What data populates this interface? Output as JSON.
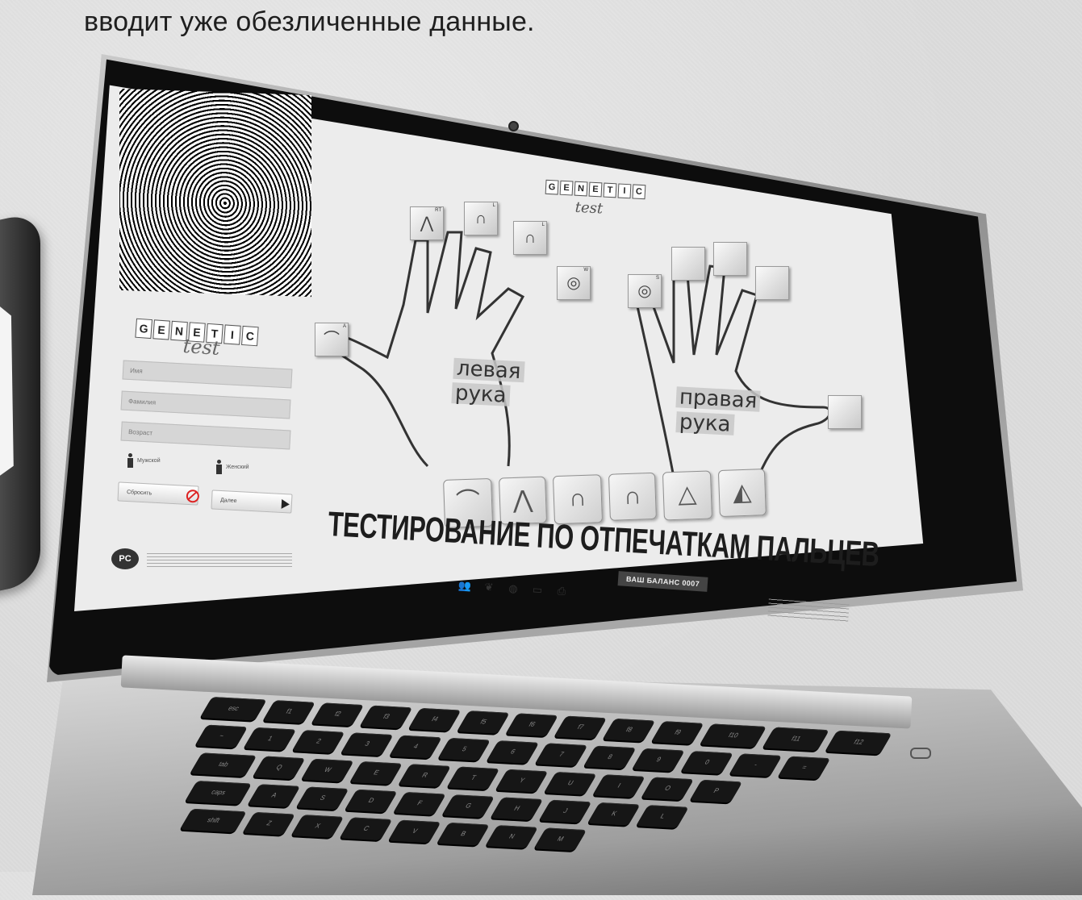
{
  "caption": {
    "text": "вводит уже обезличенные данные."
  },
  "screen": {
    "logo": {
      "letters": [
        "G",
        "E",
        "N",
        "E",
        "T",
        "I",
        "C"
      ],
      "subtitle": "test"
    },
    "form": {
      "fields": [
        {
          "placeholder": "Имя"
        },
        {
          "placeholder": "Фамилия"
        },
        {
          "placeholder": "Возраст"
        }
      ],
      "gender_male": "Мужской",
      "gender_female": "Женский",
      "clear_button": "Сбросить",
      "next_button": "Далее"
    },
    "left_hand": {
      "label_line1": "левая",
      "label_line2": "рука",
      "fingers": [
        {
          "tag": "A",
          "icon": "arch-icon"
        },
        {
          "tag": "RT",
          "icon": "tented-arch-icon"
        },
        {
          "tag": "L",
          "icon": "loop-icon"
        },
        {
          "tag": "L",
          "icon": "loop-icon"
        },
        {
          "tag": "W",
          "icon": "whorl-icon"
        }
      ]
    },
    "right_hand": {
      "label_line1": "правая",
      "label_line2": "рука",
      "fingers": [
        {
          "tag": "S",
          "icon": "whorl-icon"
        },
        {
          "tag": "",
          "icon": "empty"
        },
        {
          "tag": "",
          "icon": "empty"
        },
        {
          "tag": "",
          "icon": "empty"
        },
        {
          "tag": "",
          "icon": "empty"
        }
      ]
    },
    "patterns": [
      "arch-icon",
      "tented-arch-icon",
      "loop-icon",
      "loop-icon",
      "whorl-icon",
      "whorl-icon"
    ],
    "headline": "ТЕСТИРОВАНИЕ ПО ОТПЕЧАТКАМ ПАЛЬЦЕВ",
    "balance": "ВАШ БАЛАНС 0007",
    "toolbar_icons": [
      "users-icon",
      "chat-icon",
      "globe-icon",
      "monitor-icon",
      "printer-icon"
    ],
    "rst_badge": "PC"
  },
  "keyboard": {
    "row1": [
      "esc",
      "f1",
      "f2",
      "f3",
      "f4",
      "f5",
      "f6",
      "f7",
      "f8",
      "f9",
      "f10",
      "f11",
      "f12"
    ],
    "row2": [
      "~",
      "1",
      "2",
      "3",
      "4",
      "5",
      "6",
      "7",
      "8",
      "9",
      "0",
      "-",
      "="
    ],
    "row3": [
      "tab",
      "Q",
      "W",
      "E",
      "R",
      "T",
      "Y",
      "U",
      "I",
      "O",
      "P"
    ],
    "row4": [
      "caps",
      "A",
      "S",
      "D",
      "F",
      "G",
      "H",
      "J",
      "K",
      "L"
    ],
    "row5": [
      "shift",
      "Z",
      "X",
      "C",
      "V",
      "B",
      "N",
      "M"
    ]
  }
}
